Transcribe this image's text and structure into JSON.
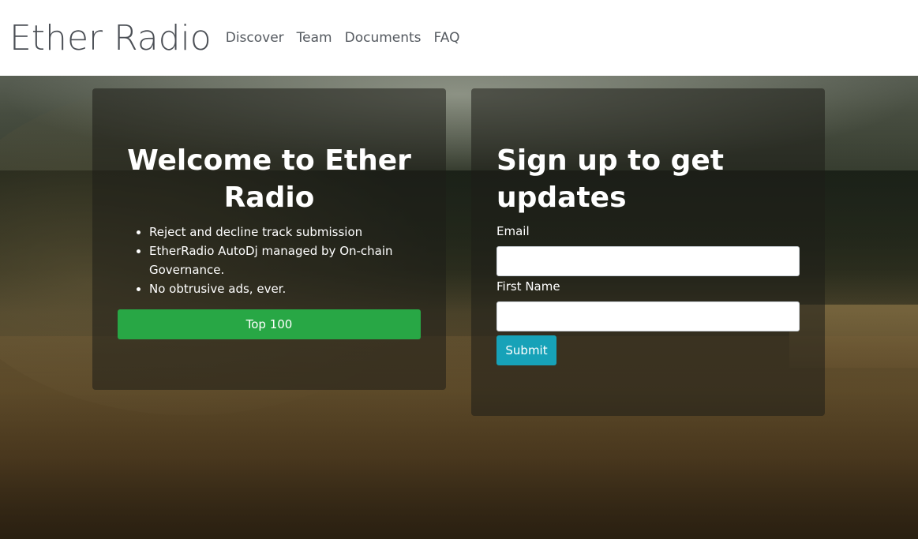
{
  "navbar": {
    "brand": "Ether Radio",
    "links": [
      "Discover",
      "Team",
      "Documents",
      "FAQ"
    ]
  },
  "welcome": {
    "title": "Welcome to Ether Radio",
    "features": [
      "Reject and decline track submission",
      "EtherRadio AutoDj managed by On-chain Governance.",
      "No obtrusive ads, ever."
    ],
    "button_label": "Top 100"
  },
  "signup": {
    "title": "Sign up to get updates",
    "email_label": "Email",
    "email_value": "",
    "first_name_label": "First Name",
    "first_name_value": "",
    "submit_label": "Submit"
  },
  "colors": {
    "top100_button": "#28a745",
    "submit_button": "#17a2b8"
  }
}
